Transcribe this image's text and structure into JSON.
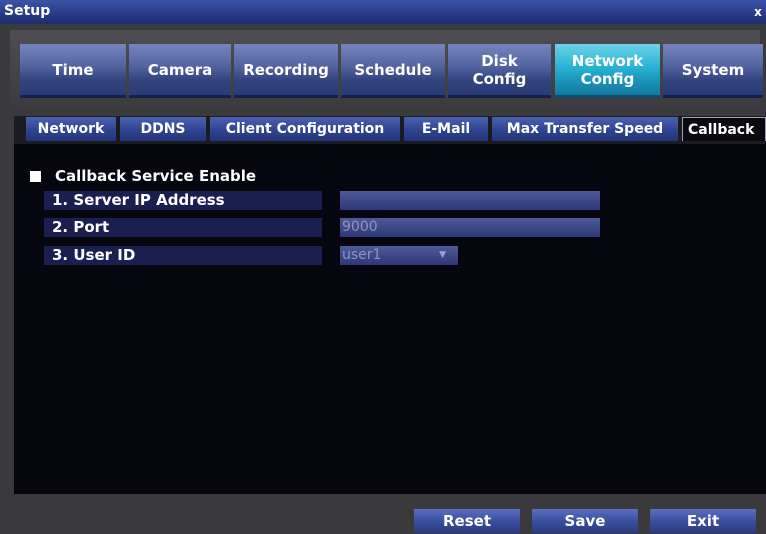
{
  "window": {
    "title": "Setup",
    "close_glyph": "x"
  },
  "main_tabs": [
    {
      "label": "Time",
      "active": false
    },
    {
      "label": "Camera",
      "active": false
    },
    {
      "label": "Recording",
      "active": false
    },
    {
      "label": "Schedule",
      "active": false
    },
    {
      "label": "Disk\nConfig",
      "active": false
    },
    {
      "label": "Network\nConfig",
      "active": true
    },
    {
      "label": "System",
      "active": false
    }
  ],
  "sub_tabs": [
    {
      "label": "Network",
      "active": false
    },
    {
      "label": "DDNS",
      "active": false
    },
    {
      "label": "Client Configuration",
      "active": false
    },
    {
      "label": "E-Mail",
      "active": false
    },
    {
      "label": "Max Transfer Speed",
      "active": false
    },
    {
      "label": "Callback",
      "active": true
    }
  ],
  "callback": {
    "enable_label": "Callback Service Enable",
    "enabled": true,
    "fields": [
      {
        "label": "1. Server IP Address",
        "value": ""
      },
      {
        "label": "2. Port",
        "value": "9000"
      },
      {
        "label": "3. User ID",
        "value": "user1"
      }
    ]
  },
  "buttons": {
    "reset": "Reset",
    "save": "Save",
    "exit": "Exit"
  },
  "colors": {
    "accent": "#28b3d4",
    "tab": "#51629f",
    "background": "#06060f"
  }
}
